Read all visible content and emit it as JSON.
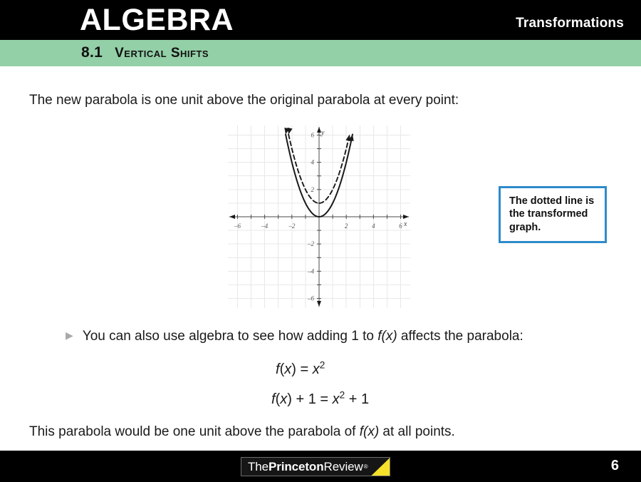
{
  "header": {
    "title": "ALGEBRA",
    "topic": "Transformations",
    "section_number": "8.1",
    "section_title": "Vertical Shifts",
    "band_color": "#000000",
    "subhead_color": "#93cfa7"
  },
  "body": {
    "intro_text": "The new parabola is one unit above the original parabola at every point:",
    "bullet_marker": "▶",
    "bullet_text_prefix": "You can also use algebra to see how adding 1 to ",
    "bullet_text_func": "f(x)",
    "bullet_text_suffix": " affects the parabola:",
    "equation_1": "f(x) = x²",
    "equation_2": "f(x) + 1 = x² + 1",
    "closing_prefix": "This parabola would be one unit above the parabola of ",
    "closing_func": "f(x)",
    "closing_suffix": " at all points."
  },
  "callout": {
    "text": "The dotted line is the transformed graph.",
    "border_color": "#2e8bc8"
  },
  "chart_data": {
    "type": "line",
    "title": "",
    "xlabel": "x",
    "ylabel": "y",
    "xlim": [
      -6.6,
      6.6
    ],
    "ylim": [
      -6.6,
      6.6
    ],
    "xticks": [
      -6,
      -4,
      -2,
      2,
      4,
      6
    ],
    "yticks": [
      -6,
      -4,
      -2,
      2,
      4,
      6
    ],
    "grid": true,
    "grid_step": 1,
    "grid_color": "#e8e8e8",
    "axis_color": "#4a4a4a",
    "series": [
      {
        "name": "original parabola",
        "equation": "y = x^2",
        "style": "solid",
        "color": "#1a1a1a",
        "vertex": [
          0,
          0
        ],
        "x": [
          -2.45,
          -2.0,
          -1.5,
          -1.0,
          -0.5,
          0,
          0.5,
          1.0,
          1.5,
          2.0,
          2.45
        ],
        "y": [
          6.0,
          4.0,
          2.25,
          1.0,
          0.25,
          0,
          0.25,
          1.0,
          2.25,
          4.0,
          6.0
        ]
      },
      {
        "name": "transformed parabola",
        "equation": "y = x^2 + 1",
        "style": "dashed",
        "color": "#1a1a1a",
        "vertex": [
          0,
          1
        ],
        "x": [
          -2.24,
          -2.0,
          -1.5,
          -1.0,
          -0.5,
          0,
          0.5,
          1.0,
          1.5,
          2.0,
          2.24
        ],
        "y": [
          6.0,
          5.0,
          3.25,
          2.0,
          1.25,
          1,
          1.25,
          2.0,
          3.25,
          5.0,
          6.0
        ]
      }
    ]
  },
  "footer": {
    "logo_the": "The ",
    "logo_princeton": "Princeton",
    "logo_review": " Review",
    "logo_registered": "®",
    "page_number": "6",
    "accent_color": "#f5e02a"
  }
}
